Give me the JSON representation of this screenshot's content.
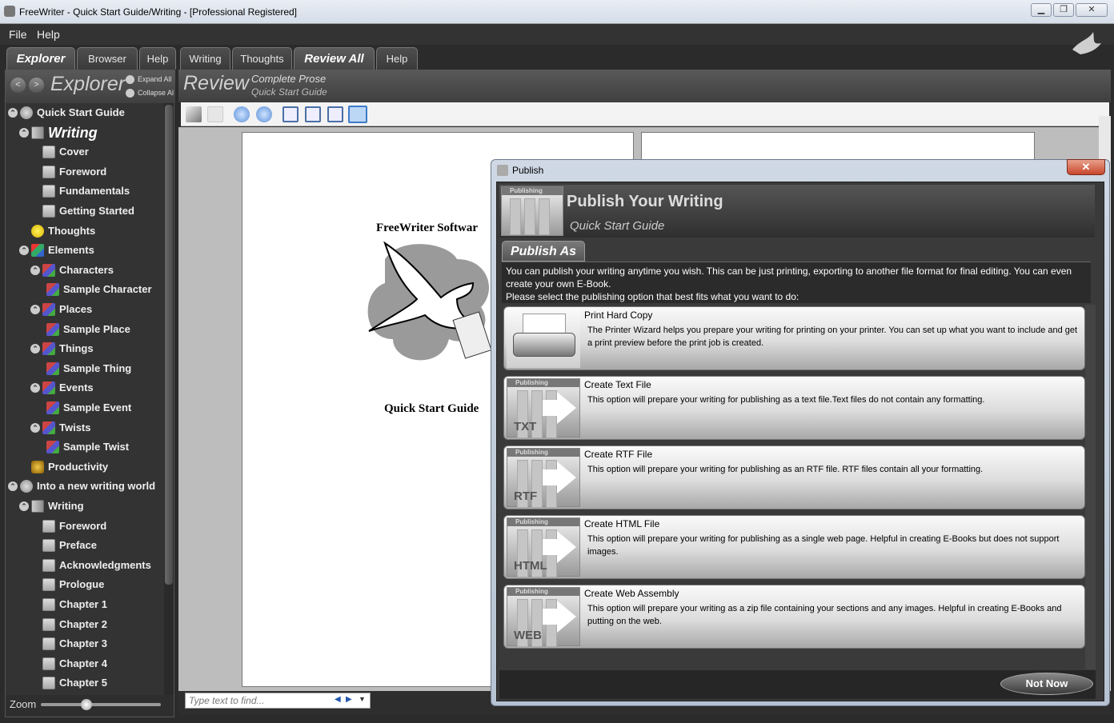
{
  "window": {
    "title": "FreeWriter - Quick Start Guide/Writing - [Professional Registered]"
  },
  "menu": [
    "File",
    "Help"
  ],
  "left_tabs": [
    "Explorer",
    "Browser",
    "Help"
  ],
  "main_tabs": [
    "Writing",
    "Thoughts",
    "Review All",
    "Help"
  ],
  "explorer": {
    "title": "Explorer",
    "expand_all": "Expand All",
    "collapse_all": "Collapse All"
  },
  "tree": [
    {
      "label": "Quick Start Guide",
      "icon": "globe-icon",
      "level": 0,
      "toggle": true
    },
    {
      "label": "Writing",
      "icon": "book-icon",
      "level": 1,
      "toggle": true,
      "selected": true
    },
    {
      "label": "Cover",
      "icon": "document-icon",
      "level": 2
    },
    {
      "label": "Foreword",
      "icon": "document-icon",
      "level": 2
    },
    {
      "label": "Fundamentals",
      "icon": "document-icon",
      "level": 2
    },
    {
      "label": "Getting Started",
      "icon": "document-icon",
      "level": 2
    },
    {
      "label": "Thoughts",
      "icon": "lightbulb-icon",
      "level": 1
    },
    {
      "label": "Elements",
      "icon": "blocks-icon",
      "level": 1,
      "toggle": true
    },
    {
      "label": "Characters",
      "icon": "puzzle-icon",
      "level": 2,
      "toggle": true
    },
    {
      "label": "Sample Character",
      "icon": "puzzle-icon",
      "level": 3
    },
    {
      "label": "Places",
      "icon": "puzzle-icon",
      "level": 2,
      "toggle": true
    },
    {
      "label": "Sample Place",
      "icon": "puzzle-icon",
      "level": 3
    },
    {
      "label": "Things",
      "icon": "puzzle-icon",
      "level": 2,
      "toggle": true
    },
    {
      "label": "Sample Thing",
      "icon": "puzzle-icon",
      "level": 3
    },
    {
      "label": "Events",
      "icon": "puzzle-icon",
      "level": 2,
      "toggle": true
    },
    {
      "label": "Sample Event",
      "icon": "puzzle-icon",
      "level": 3
    },
    {
      "label": "Twists",
      "icon": "puzzle-icon",
      "level": 2,
      "toggle": true
    },
    {
      "label": "Sample Twist",
      "icon": "puzzle-icon",
      "level": 3
    },
    {
      "label": "Productivity",
      "icon": "gears-icon",
      "level": 1
    },
    {
      "label": "Into a new writing world",
      "icon": "globe-icon",
      "level": 0,
      "toggle": true
    },
    {
      "label": "Writing",
      "icon": "book-icon",
      "level": 1,
      "toggle": true
    },
    {
      "label": "Foreword",
      "icon": "document-icon",
      "level": 2
    },
    {
      "label": "Preface",
      "icon": "document-icon",
      "level": 2
    },
    {
      "label": "Acknowledgments",
      "icon": "document-icon",
      "level": 2
    },
    {
      "label": "Prologue",
      "icon": "document-icon",
      "level": 2
    },
    {
      "label": "Chapter 1",
      "icon": "document-icon",
      "level": 2
    },
    {
      "label": "Chapter 2",
      "icon": "document-icon",
      "level": 2
    },
    {
      "label": "Chapter 3",
      "icon": "document-icon",
      "level": 2
    },
    {
      "label": "Chapter 4",
      "icon": "document-icon",
      "level": 2
    },
    {
      "label": "Chapter 5",
      "icon": "document-icon",
      "level": 2
    }
  ],
  "zoom_label": "Zoom",
  "zoom_level": 0.38,
  "review": {
    "title": "Review",
    "subtitle1": "Complete Prose",
    "subtitle2": "Quick Start Guide"
  },
  "document": {
    "header": "FreeWriter Softwar",
    "footer": "Quick Start Guide"
  },
  "find": {
    "placeholder": "Type text to find..."
  },
  "dialog": {
    "title": "Publish",
    "heading": "Publish Your Writing",
    "subheading": "Quick Start Guide",
    "icon_caption": "Publishing",
    "tab": "Publish As",
    "description": "You can publish your writing anytime you wish. This can be just printing, exporting to another file format for final editing. You can even create your own E-Book.",
    "instruction": "Please select the publishing option that best fits what you want to do:",
    "options": [
      {
        "title": "Print Hard Copy",
        "desc": "The Printer Wizard helps you prepare your writing for printing on your printer. You can set up what you want to include and get a print preview before the print job is created.",
        "ext": ""
      },
      {
        "title": "Create Text File",
        "desc": "This option will prepare your writing for publishing as a text file.Text files do not contain any formatting.",
        "ext": "TXT"
      },
      {
        "title": "Create RTF File",
        "desc": "This option will prepare your writing for publishing as an RTF file. RTF files contain all your formatting.",
        "ext": "RTF"
      },
      {
        "title": "Create HTML File",
        "desc": "This option will prepare your writing for publishing as a single web page. Helpful in creating E-Books but does not support images.",
        "ext": "HTML"
      },
      {
        "title": "Create Web Assembly",
        "desc": "This option will prepare your writing as a zip file containing your sections and any images. Helpful in creating E-Books and putting on the web.",
        "ext": "WEB"
      }
    ],
    "button": "Not Now"
  }
}
